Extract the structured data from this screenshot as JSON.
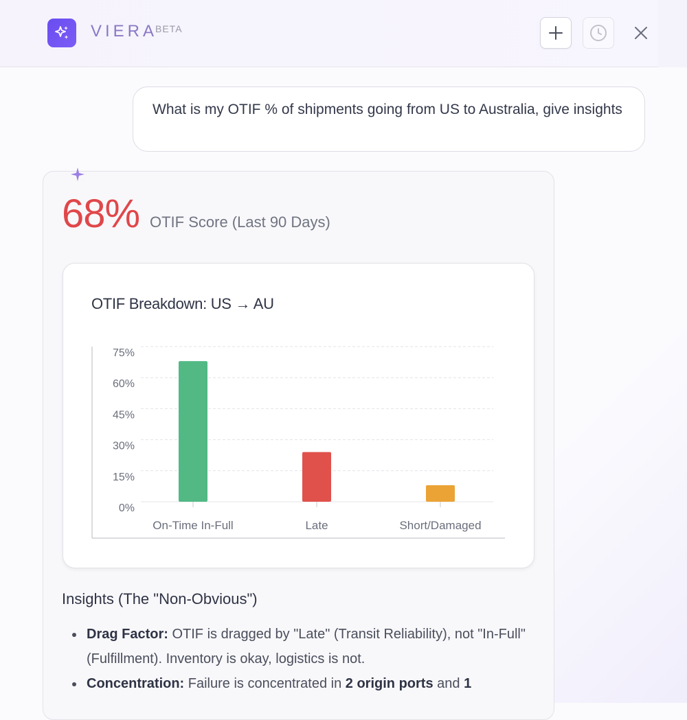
{
  "header": {
    "brand": "VIERA",
    "badge": "BETA",
    "buttons": {
      "new_chat": "plus-icon",
      "history": "clock-icon",
      "close": "close-icon"
    }
  },
  "query": {
    "text": "What is my OTIF % of shipments going from US to Australia, give insights"
  },
  "answer": {
    "score_value": "68%",
    "score_label": "OTIF Score (Last 90 Days)",
    "colors": {
      "score": "#e0474a",
      "accent": "#6a4df0"
    }
  },
  "chart_data": {
    "type": "bar",
    "title": "OTIF Breakdown: US → AU",
    "categories": [
      "On-Time In-Full",
      "Late",
      "Short/Damaged"
    ],
    "values": [
      68,
      24,
      8
    ],
    "colors": [
      "#52b984",
      "#e0514b",
      "#eba336"
    ],
    "ylim": [
      0,
      75
    ],
    "yticks": [
      0,
      15,
      30,
      45,
      60,
      75
    ],
    "ytick_labels": [
      "0%",
      "15%",
      "30%",
      "45%",
      "60%",
      "75%"
    ],
    "grid": true,
    "xlabel": "",
    "ylabel": ""
  },
  "insights": {
    "title": "Insights (The \"Non-Obvious\")",
    "items": [
      {
        "label": "Drag Factor:",
        "text1": " OTIF is dragged by \"Late\" (Transit Reliability), not \"In-Full\" (Fulfillment). Inventory is okay, logistics is not.",
        "bold2": "",
        "text2": "",
        "bold3": ""
      },
      {
        "label": "Concentration:",
        "text1": " Failure is concentrated in ",
        "bold2": "2 origin ports",
        "text2": " and ",
        "bold3": "1"
      }
    ]
  }
}
